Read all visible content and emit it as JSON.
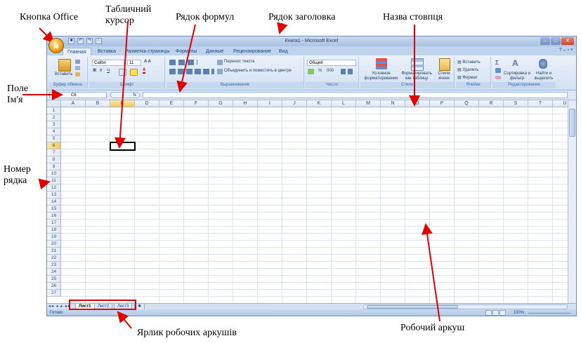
{
  "annotations": {
    "office_button": "Кнопка Office",
    "cell_cursor": "Табличний курсор",
    "formula_bar": "Рядок формул",
    "title_bar": "Рядок заголовка",
    "column_name": "Назва стовпця",
    "name_box": "Поле Ім'я",
    "row_number": "Номер рядка",
    "sheet_tabs": "Ярлик робочих аркушів",
    "worksheet": "Робочий аркуш"
  },
  "excel": {
    "window_title": "Книга1 - Microsoft Excel",
    "window_buttons": [
      "–",
      "□",
      "X"
    ],
    "tabs": [
      "Главная",
      "Вставка",
      "Разметка страницы",
      "Формулы",
      "Данные",
      "Рецензирование",
      "Вид"
    ],
    "ribbon": {
      "clipboard": {
        "label": "Буфер обмена",
        "paste": "Вставить"
      },
      "font": {
        "label": "Шрифт",
        "font_name": "Calibri",
        "font_size": "11",
        "bold": "Ж",
        "italic": "К",
        "underline": "Ч"
      },
      "alignment": {
        "label": "Выравнивание",
        "wrap": "Перенос текста",
        "merge": "Объединить и поместить в центре"
      },
      "number": {
        "label": "Число",
        "format": "Общий",
        "percent": "%",
        "thousands": "000"
      },
      "styles": {
        "label": "Стили",
        "conditional": "Условное форматирование",
        "as_table": "Форматировать как таблицу",
        "cell_styles": "Стили ячеек"
      },
      "cells": {
        "label": "Ячейки",
        "insert": "Вставить",
        "delete": "Удалить",
        "format": "Формат"
      },
      "editing": {
        "label": "Редактирование",
        "sort": "Сортировка и фильтр",
        "find": "Найти и выделить"
      }
    },
    "name_box": "C6",
    "fx": "fx",
    "columns": [
      "A",
      "B",
      "C",
      "D",
      "E",
      "F",
      "G",
      "H",
      "I",
      "J",
      "K",
      "L",
      "M",
      "N",
      "O",
      "P",
      "Q",
      "R",
      "S",
      "T",
      "U"
    ],
    "selected_column": "C",
    "rows": [
      "1",
      "2",
      "3",
      "4",
      "5",
      "6",
      "7",
      "8",
      "9",
      "10",
      "11",
      "12",
      "13",
      "14",
      "15",
      "16",
      "17",
      "18",
      "19",
      "20",
      "21",
      "22",
      "23",
      "24",
      "25",
      "26",
      "27"
    ],
    "selected_row": "6",
    "sheets": [
      "Лист1",
      "Лист2",
      "Лист3"
    ],
    "active_sheet": "Лист1",
    "status": "Готово",
    "zoom": "100%"
  },
  "colors": {
    "annotation_arrow": "#e00000",
    "highlight_box": "#e00000",
    "ribbon": "#dbe6f4",
    "selected_header": "#f8c85a"
  }
}
